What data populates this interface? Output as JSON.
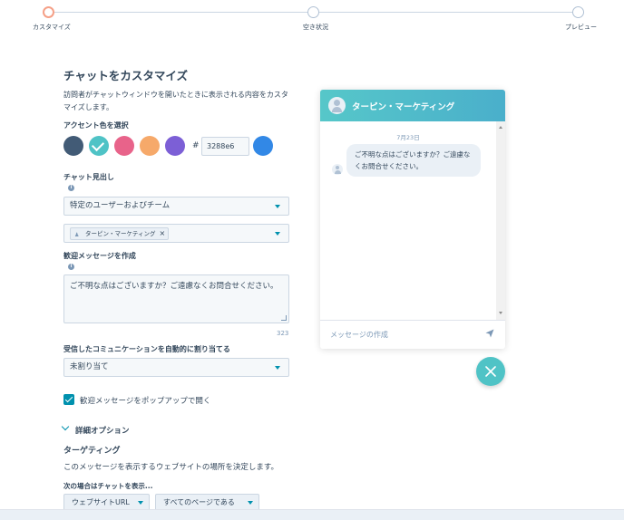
{
  "stepper": {
    "steps": [
      {
        "label": "カスタマイズ",
        "state": "active"
      },
      {
        "label": "空き状況",
        "state": "upcoming"
      },
      {
        "label": "プレビュー",
        "state": "upcoming"
      }
    ]
  },
  "form": {
    "title": "チャットをカスタマイズ",
    "description": "訪問者がチャットウィンドウを開いたときに表示される内容をカスタマイズします。",
    "accent": {
      "label": "アクセント色を選択",
      "swatches": [
        "#425b76",
        "#4fc3c6",
        "#e8638a",
        "#f6a96a",
        "#7c5fd6"
      ],
      "selected_index": 1,
      "hash": "#",
      "hex_value": "3288e6",
      "preview_color": "#3288e6"
    },
    "heading": {
      "label": "チャット見出し",
      "select_value": "特定のユーザーおよびチーム",
      "tag_label": "ターピン・マーケティング",
      "tag_remove": "×"
    },
    "welcome": {
      "label": "歓迎メッセージを作成",
      "text": "ご不明な点はございますか？ご遠慮なくお問合せください。",
      "counter": "323"
    },
    "assign": {
      "label": "受信したコミュニケーションを自動的に割り当てる",
      "select_value": "未割り当て"
    },
    "popup": {
      "label": "歓迎メッセージをポップアップで開く",
      "checked": true
    },
    "advanced": {
      "label": "詳細オプション",
      "targeting_title": "ターゲティング",
      "targeting_desc": "このメッセージを表示するウェブサイトの場所を決定します。",
      "condition_label": "次の場合はチャットを表示...",
      "filter_1": "ウェブサイトURL",
      "filter_2": "すべてのページである"
    }
  },
  "chat_preview": {
    "header_title": "ターピン・マーケティング",
    "date": "7月23日",
    "message": "ご不明な点はございますか？ご遠慮なくお問合せください。",
    "input_placeholder": "メッセージの作成",
    "accent": "#4fc3c6"
  },
  "colors": {
    "primary_text": "#33475b",
    "link": "#0091ae",
    "active_step": "#f5a087",
    "border": "#cbd6e2"
  }
}
